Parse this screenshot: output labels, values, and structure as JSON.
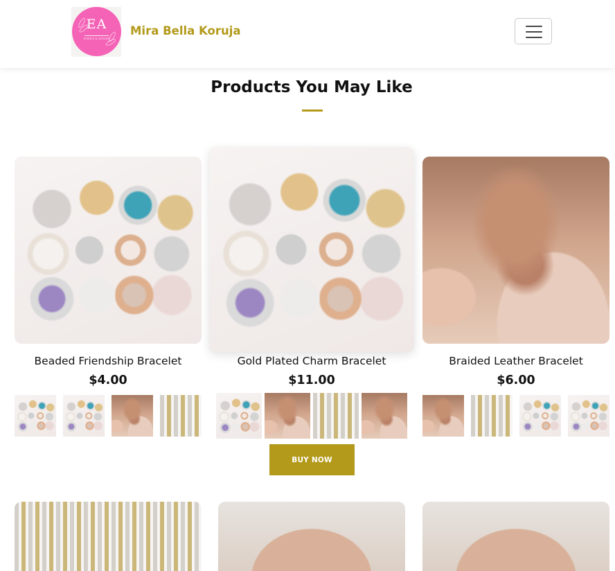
{
  "brand": {
    "logo_monogram": "EA",
    "logo_tagline": "EVENTS & AFFAIRS",
    "name": "Mira Bella Koruja",
    "accent_color": "#b39a1b"
  },
  "nav": {
    "toggler_icon": "hamburger-menu-icon"
  },
  "section": {
    "title": "Products You May Like"
  },
  "products": [
    {
      "name": "Beaded Friendship Bracelet",
      "price": "$4.00",
      "image": "jewelry-buttons-photo",
      "thumbnails": [
        "jewelry-buttons-photo",
        "jewelry-buttons-photo",
        "necklace-photo",
        "chains-photo"
      ]
    },
    {
      "name": "Gold Plated Charm Bracelet",
      "price": "$11.00",
      "image": "jewelry-buttons-photo",
      "thumbnails": [
        "jewelry-buttons-photo",
        "necklace-photo",
        "chains-photo",
        "necklace-photo"
      ]
    },
    {
      "name": "Braided Leather Bracelet",
      "price": "$6.00",
      "image": "necklace-photo",
      "thumbnails": [
        "necklace-photo",
        "chains-photo",
        "jewelry-buttons-photo",
        "jewelry-buttons-photo"
      ]
    }
  ],
  "buy_button": {
    "label": "BUY NOW"
  },
  "next_row_images": [
    "chains-photo",
    "hand-necklace-photo",
    "hand-necklace-photo"
  ]
}
